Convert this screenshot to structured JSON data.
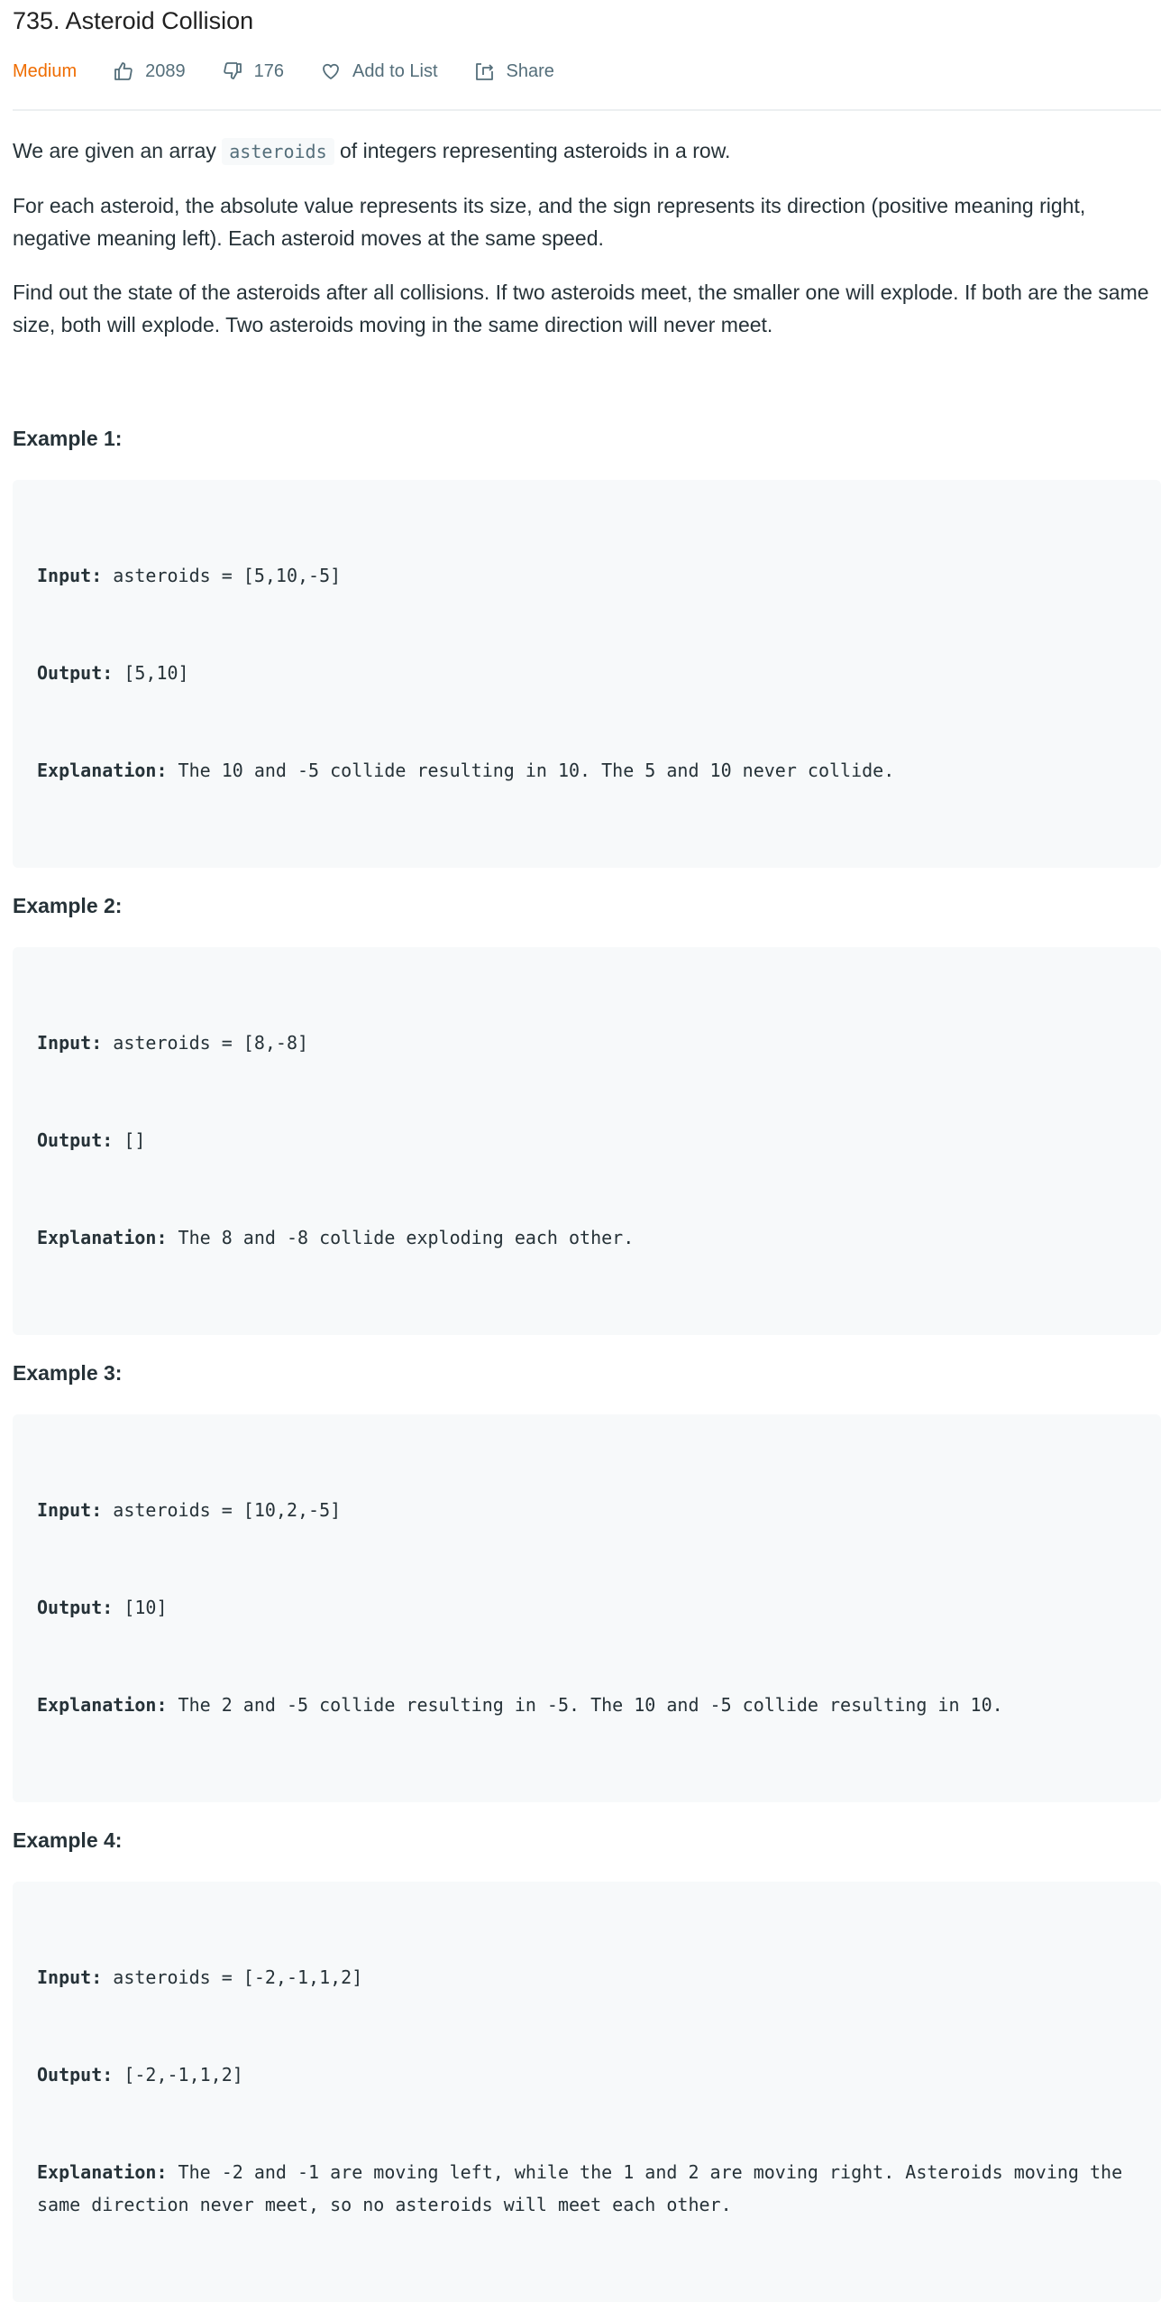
{
  "problem": {
    "title": "735. Asteroid Collision",
    "difficulty": "Medium",
    "likes": "2089",
    "dislikes": "176",
    "add_to_list_label": "Add to List",
    "share_label": "Share",
    "colors": {
      "difficulty": "#ef6c00",
      "meta": "#546e7a",
      "code_bg": "#f7f9fa"
    }
  },
  "description": {
    "p1_before": "We are given an array ",
    "p1_code": "asteroids",
    "p1_after": " of integers representing asteroids in a row.",
    "p2": "For each asteroid, the absolute value represents its size, and the sign represents its direction (positive meaning right, negative meaning left). Each asteroid moves at the same speed.",
    "p3": "Find out the state of the asteroids after all collisions. If two asteroids meet, the smaller one will explode. If both are the same size, both will explode. Two asteroids moving in the same direction will never meet."
  },
  "labels": {
    "input": "Input:",
    "output": "Output:",
    "explanation": "Explanation:"
  },
  "examples": [
    {
      "title": "Example 1:",
      "input": " asteroids = [5,10,-5]",
      "output": " [5,10]",
      "explanation": " The 10 and -5 collide resulting in 10. The 5 and 10 never collide."
    },
    {
      "title": "Example 2:",
      "input": " asteroids = [8,-8]",
      "output": " []",
      "explanation": " The 8 and -8 collide exploding each other."
    },
    {
      "title": "Example 3:",
      "input": " asteroids = [10,2,-5]",
      "output": " [10]",
      "explanation": " The 2 and -5 collide resulting in -5. The 10 and -5 collide resulting in 10."
    },
    {
      "title": "Example 4:",
      "input": " asteroids = [-2,-1,1,2]",
      "output": " [-2,-1,1,2]",
      "explanation": " The -2 and -1 are moving left, while the 1 and 2 are moving right. Asteroids moving the same direction never meet, so no asteroids will meet each other."
    }
  ]
}
